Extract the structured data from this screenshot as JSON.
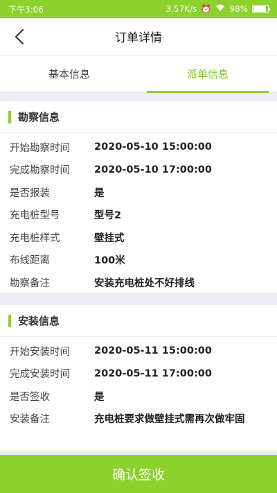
{
  "status_bar": {
    "time": "下午3:06",
    "speed": "3.57K/s",
    "battery_percent": "98%",
    "battery_level": 0.98
  },
  "nav": {
    "title": "订单详情"
  },
  "tabs": [
    {
      "label": "基本信息",
      "active": false
    },
    {
      "label": "派单信息",
      "active": true
    }
  ],
  "survey": {
    "title": "勘察信息",
    "rows": [
      {
        "label": "开始勘察时间",
        "value": "2020-05-10 15:00:00"
      },
      {
        "label": "完成勘察时间",
        "value": "2020-05-10 17:00:00"
      },
      {
        "label": "是否报装",
        "value": "是"
      },
      {
        "label": "充电桩型号",
        "value": "型号2"
      },
      {
        "label": "充电桩样式",
        "value": "壁挂式"
      },
      {
        "label": "布线距离",
        "value": "100米"
      },
      {
        "label": "勘察备注",
        "value": "安装充电桩处不好排线"
      }
    ]
  },
  "install": {
    "title": "安装信息",
    "rows": [
      {
        "label": "开始安装时间",
        "value": "2020-05-11 15:00:00"
      },
      {
        "label": "完成安装时间",
        "value": "2020-05-11 17:00:00"
      },
      {
        "label": "是否签收",
        "value": "是"
      },
      {
        "label": "安装备注",
        "value": "充电桩要求做壁挂式需再次做牢固"
      }
    ]
  },
  "confirm_label": "确认签收",
  "colors": {
    "accent": "#8dd12b",
    "tab_active": "#7cc91f",
    "background": "#eceef3"
  }
}
